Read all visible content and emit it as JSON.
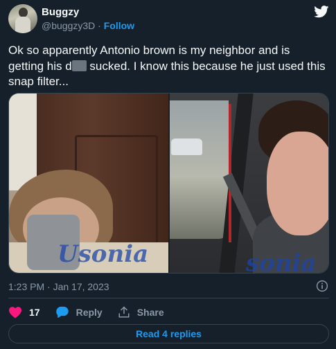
{
  "author": {
    "name": "Buggzy",
    "handle": "@buggzy3D",
    "separator": " · ",
    "follow_label": "Follow"
  },
  "tweet": {
    "text_part1": "Ok so apparently Antonio brown is my neighbor and is getting his d",
    "text_part2": " sucked. I know this because he just used this snap filter...",
    "watermark_left": "Usonia",
    "watermark_right": "sonia"
  },
  "meta": {
    "timestamp": "1:23 PM · Jan 17, 2023"
  },
  "actions": {
    "like_count": "17",
    "reply_label": "Reply",
    "share_label": "Share"
  },
  "replies_button": "Read 4 replies",
  "colors": {
    "background": "#15202b",
    "accent": "#1d9bf0",
    "like": "#f91880",
    "secondary_text": "#8b98a5",
    "border": "#38444d"
  },
  "icons": [
    "twitter-bird-icon",
    "info-icon",
    "heart-icon",
    "reply-icon",
    "share-icon"
  ]
}
